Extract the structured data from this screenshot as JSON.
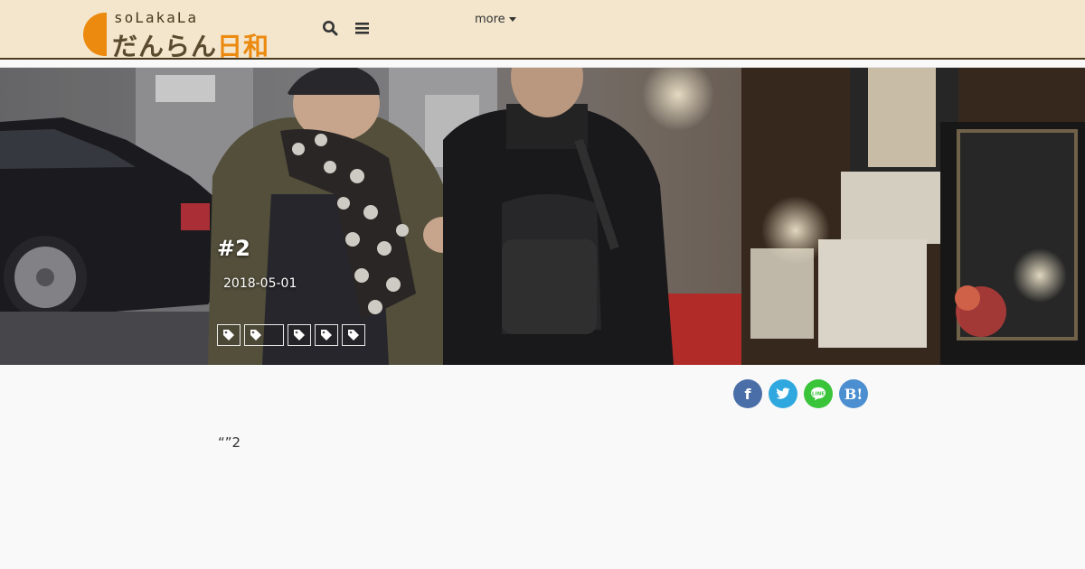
{
  "header": {
    "logo_sub": "soLakaLa",
    "logo_main_kana": "だんらん",
    "logo_main_kanji": "日和",
    "more_label": "more",
    "search_icon": "search-icon",
    "menu_icon": "menu-icon"
  },
  "hero": {
    "title": "#2",
    "date": "2018-05-01",
    "tags": [
      {
        "icon": "tag-icon",
        "label": ""
      },
      {
        "icon": "tag-icon",
        "label": ""
      },
      {
        "icon": "tag-icon",
        "label": ""
      },
      {
        "icon": "tag-icon",
        "label": ""
      },
      {
        "icon": "tag-icon",
        "label": ""
      }
    ]
  },
  "share": {
    "facebook": "f",
    "hatena": "B!"
  },
  "article": {
    "body": "“”2"
  },
  "colors": {
    "header_bg": "#f3e6cc",
    "accent": "#ec8a10",
    "facebook": "#4a6ea8",
    "twitter": "#2ea8de",
    "line": "#3ac43a",
    "hatena": "#4c8fd0"
  }
}
